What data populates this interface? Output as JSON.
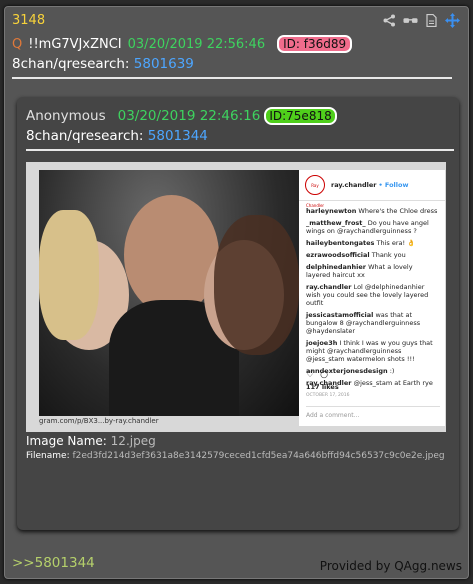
{
  "post": {
    "number": "3148",
    "q_marker": "Q",
    "tripcode": "!!mG7VJxZNCI",
    "date": "03/20/2019 22:56:46",
    "id": "ID: f36d89",
    "board": "8chan/qresearch:",
    "board_post": "5801639",
    "backlink": ">>5801344",
    "provided_by": "Provided by QAgg.news"
  },
  "icons": [
    "share-icon",
    "glasses-icon",
    "document-icon",
    "move-icon"
  ],
  "quoted": {
    "author": "Anonymous",
    "date": "03/20/2019 22:46:16",
    "id": "ID:75e818",
    "board": "8chan/qresearch:",
    "board_post": "5801344",
    "image_name_label": "Image Name:",
    "image_name": "12.jpeg",
    "filename_label": "Filename:",
    "filename": "f2ed3fd214d3ef3631a8e3142579ceced1cfd5ea74a646bffd94c56537c9c0e2e.jpeg",
    "photo_caption": "gram.com/p/BX3...by-ray.chandler",
    "instagram": {
      "username": "ray.chandler",
      "follow": "• Follow",
      "avatar_text": "Ray Chandler",
      "comments": [
        {
          "user": "harleynewton",
          "text": "Where's the Chloe dress"
        },
        {
          "user": "_matthew_frost_",
          "text": "Do you have angel wings on @raychandlerguinness ?"
        },
        {
          "user": "haileybentongates",
          "text": "This era! 👌"
        },
        {
          "user": "ezrawoodsofficial",
          "text": "Thank you"
        },
        {
          "user": "delphinedanhier",
          "text": "What a lovely layered haircut xx"
        },
        {
          "user": "ray.chandler",
          "text": "Lol @delphinedanhier wish you could see the lovely layered outfit"
        },
        {
          "user": "jessicastamofficial",
          "text": "was that at bungalow 8 @raychandlerguinness @haydenslater"
        },
        {
          "user": "joejoe3h",
          "text": "I think I was w you guys that might @raychandlerguinness @jess_stam watermelon shots !!!"
        },
        {
          "user": "anndexterjonesdesign",
          "text": ":)"
        },
        {
          "user": "ray.chandler",
          "text": "@jess_stam at Earth rye"
        }
      ],
      "likes": "117 likes",
      "time": "OCTOBER 17, 2016",
      "add_comment": "Add a comment..."
    }
  }
}
